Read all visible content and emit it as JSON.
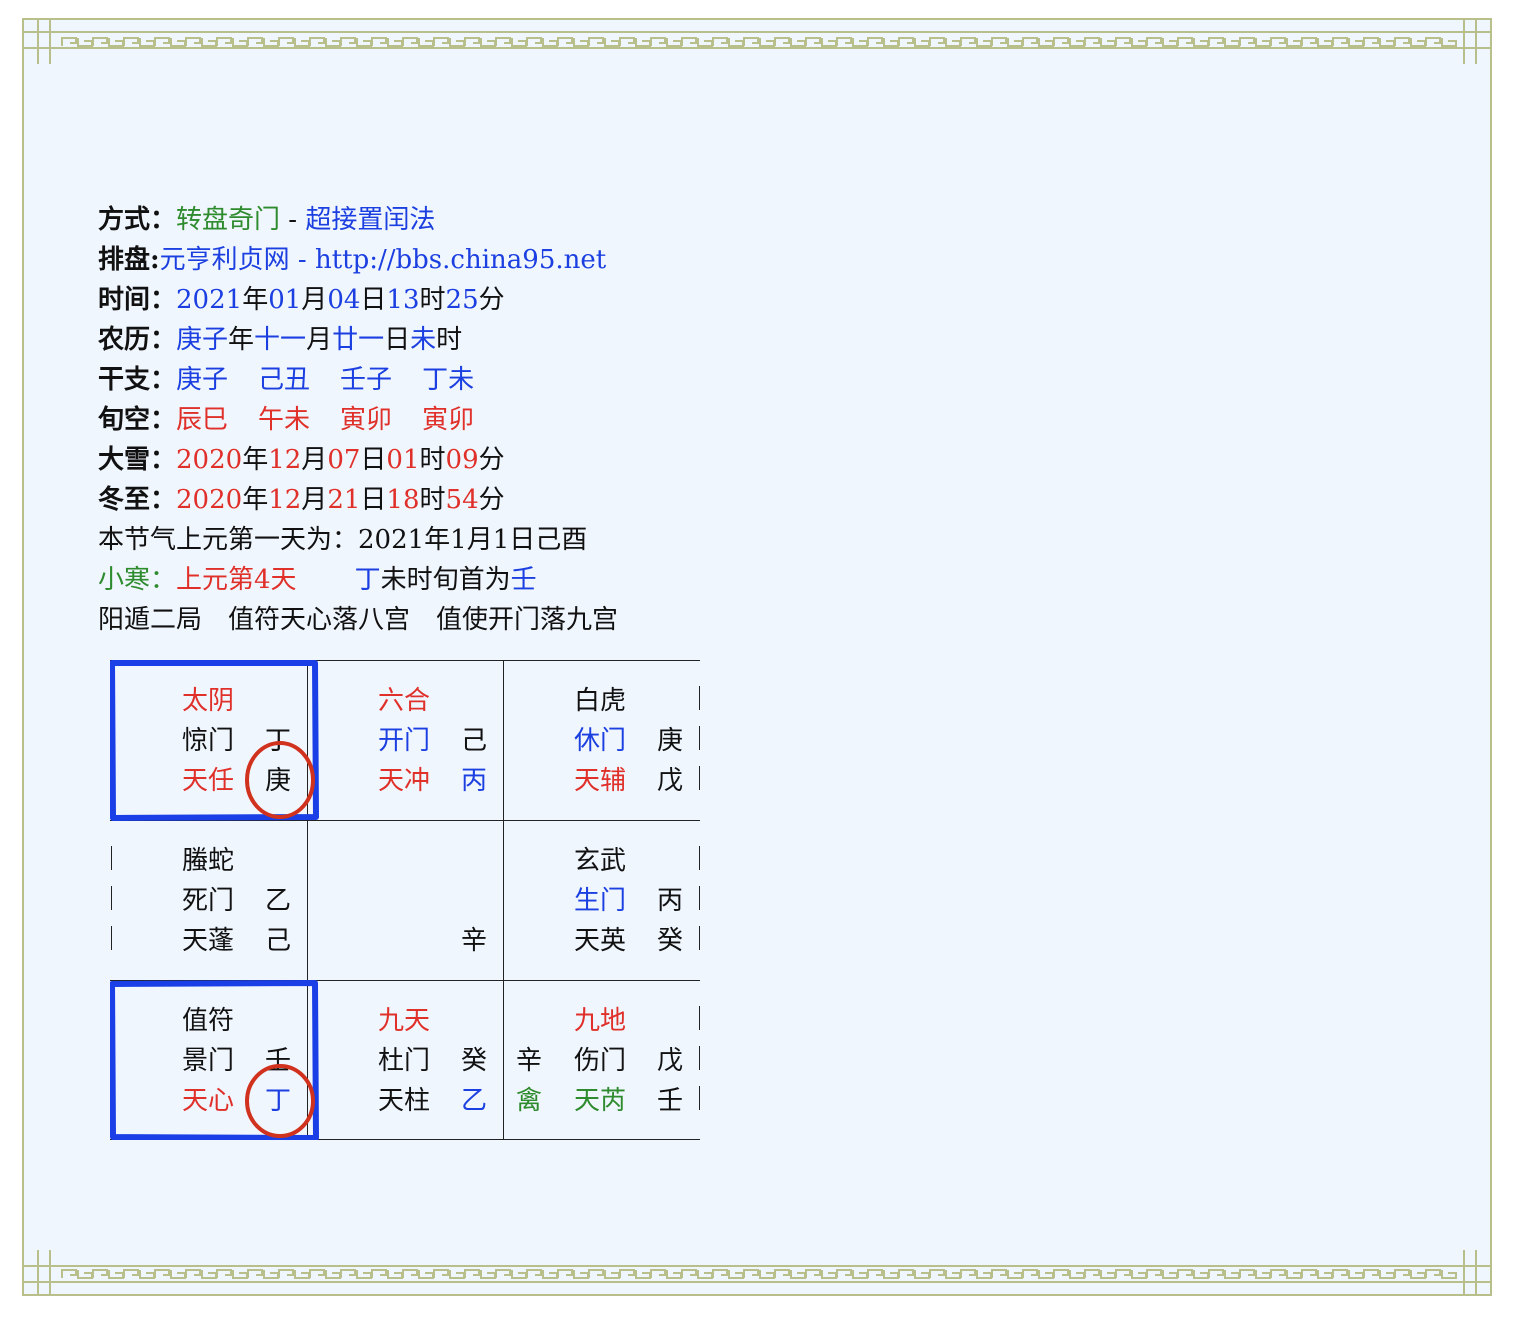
{
  "header": {
    "fangshi": {
      "label": "方式：",
      "value1": "转盘奇门",
      "sep": " - ",
      "value2": "超接置闰法"
    },
    "paipan": {
      "label": "排盘:",
      "site": "元亨利贞网",
      "sep": " - ",
      "url": "http://bbs.china95.net"
    },
    "shijian": {
      "label": "时间：",
      "year": "2021",
      "y": "年",
      "month": "01",
      "m": "月",
      "day": "04",
      "d": "日",
      "hour": "13",
      "h": "时",
      "minute": "25",
      "mi": "分"
    },
    "nongli": {
      "label": "农历：",
      "year": "庚子",
      "y": "年",
      "month": "十一",
      "m": "月",
      "day": "廿一",
      "d": "日",
      "hour": "未",
      "h": "时"
    },
    "ganzhi": {
      "label": "干支：",
      "values": [
        "庚子",
        "己丑",
        "壬子",
        "丁未"
      ]
    },
    "xunkong": {
      "label": "旬空：",
      "values": [
        "辰巳",
        "午未",
        "寅卯",
        "寅卯"
      ]
    },
    "daxue": {
      "label": "大雪：",
      "year": "2020",
      "y": "年",
      "month": "12",
      "m": "月",
      "day": "07",
      "d": "日",
      "hour": "01",
      "h": "时",
      "minute": "09",
      "mi": "分"
    },
    "dongzhi": {
      "label": "冬至：",
      "year": "2020",
      "y": "年",
      "month": "12",
      "m": "月",
      "day": "21",
      "d": "日",
      "hour": "18",
      "h": "时",
      "minute": "54",
      "mi": "分"
    },
    "shangyuan": "本节气上元第一天为：2021年1月1日己酉",
    "xiaohan": {
      "label": "小寒：",
      "value": "上元第4天",
      "xunshou_pre": "丁",
      "xunshou_mid": "未时旬首为",
      "xunshou_gan": "壬"
    },
    "ju": "阳遁二局　值符天心落八宫　值使开门落九宫"
  },
  "palaces": [
    {
      "shen": "太阴",
      "men": "惊门",
      "men_gan": "丁",
      "xing": "天任",
      "xing_gan": "庚",
      "left": ""
    },
    {
      "shen": "六合",
      "men": "开门",
      "men_gan": "己",
      "xing": "天冲",
      "xing_gan": "丙",
      "left": ""
    },
    {
      "shen": "白虎",
      "men": "休门",
      "men_gan": "庚",
      "xing": "天辅",
      "xing_gan": "戊",
      "left": ""
    },
    {
      "shen": "螣蛇",
      "men": "死门",
      "men_gan": "乙",
      "xing": "天蓬",
      "xing_gan": "己",
      "left": ""
    },
    {
      "shen": "",
      "men": "",
      "men_gan": "",
      "xing": "",
      "xing_gan": "辛",
      "left": ""
    },
    {
      "shen": "玄武",
      "men": "生门",
      "men_gan": "丙",
      "xing": "天英",
      "xing_gan": "癸",
      "left": ""
    },
    {
      "shen": "值符",
      "men": "景门",
      "men_gan": "壬",
      "xing": "天心",
      "xing_gan": "丁",
      "left": ""
    },
    {
      "shen": "九天",
      "men": "杜门",
      "men_gan": "癸",
      "xing": "天柱",
      "xing_gan": "乙",
      "left": ""
    },
    {
      "shen": "九地",
      "men": "伤门",
      "men_gan": "戊",
      "xing": "天芮",
      "xing_gan": "壬",
      "left_top": "辛",
      "left_bottom": "禽"
    }
  ],
  "colors": {
    "red": "#e0302a",
    "blue": "#1b3fe0",
    "green": "#2e8b2e",
    "frame": "#b9bf8a",
    "background": "#f0f6fe",
    "mark_blue": "#1a3fe6",
    "mark_red": "#d0321e"
  }
}
